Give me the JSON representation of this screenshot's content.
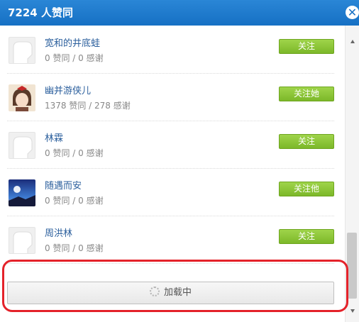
{
  "dialog": {
    "title": "7224 人赞同",
    "close_icon": "close-icon"
  },
  "users": [
    {
      "name": "宽和的井底蛙",
      "stats": "0 赞同 / 0 感谢",
      "follow_label": "关注",
      "avatar": "default"
    },
    {
      "name": "幽并游侠儿",
      "stats": "1378 赞同 / 278 感谢",
      "follow_label": "关注她",
      "avatar": "anime-girl"
    },
    {
      "name": "林霖",
      "stats": "0 赞同 / 0 感谢",
      "follow_label": "关注",
      "avatar": "default"
    },
    {
      "name": "随遇而安",
      "stats": "0 赞同 / 0 感谢",
      "follow_label": "关注他",
      "avatar": "night-sky"
    },
    {
      "name": "周洪林",
      "stats": "0 赞同 / 0 感谢",
      "follow_label": "关注",
      "avatar": "default"
    }
  ],
  "load_more": {
    "label": "加载中",
    "icon": "loading-spinner-icon"
  },
  "colors": {
    "title_bar": "#1670c4",
    "follow_button": "#7cb829",
    "username": "#2a5e9c",
    "annotation": "#e4222a"
  }
}
